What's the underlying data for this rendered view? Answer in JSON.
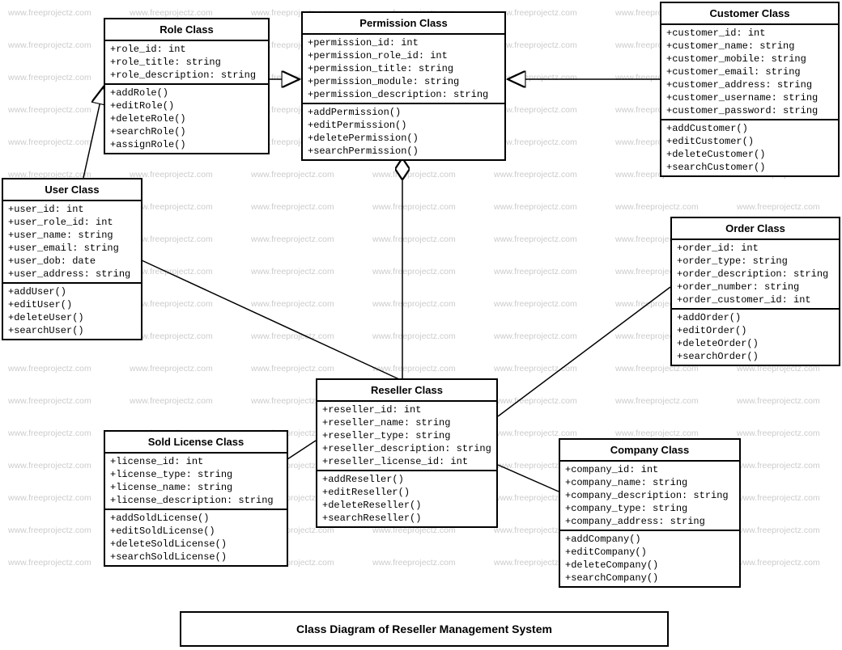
{
  "watermark": "www.freeprojectz.com",
  "caption": "Class Diagram of Reseller Management System",
  "classes": {
    "role": {
      "title": "Role Class",
      "attrs": [
        "+role_id: int",
        "+role_title: string",
        "+role_description: string"
      ],
      "ops": [
        "+addRole()",
        "+editRole()",
        "+deleteRole()",
        "+searchRole()",
        "+assignRole()"
      ]
    },
    "permission": {
      "title": "Permission Class",
      "attrs": [
        "+permission_id: int",
        "+permission_role_id: int",
        "+permission_title: string",
        "+permission_module: string",
        "+permission_description: string"
      ],
      "ops": [
        "+addPermission()",
        "+editPermission()",
        "+deletePermission()",
        "+searchPermission()"
      ]
    },
    "customer": {
      "title": "Customer Class",
      "attrs": [
        "+customer_id: int",
        "+customer_name: string",
        "+customer_mobile: string",
        "+customer_email: string",
        "+customer_address: string",
        "+customer_username: string",
        "+customer_password: string"
      ],
      "ops": [
        "+addCustomer()",
        "+editCustomer()",
        "+deleteCustomer()",
        "+searchCustomer()"
      ]
    },
    "user": {
      "title": "User Class",
      "attrs": [
        "+user_id: int",
        "+user_role_id: int",
        "+user_name: string",
        "+user_email: string",
        "+user_dob: date",
        "+user_address: string"
      ],
      "ops": [
        "+addUser()",
        "+editUser()",
        "+deleteUser()",
        "+searchUser()"
      ]
    },
    "order": {
      "title": "Order Class",
      "attrs": [
        "+order_id: int",
        "+order_type: string",
        "+order_description: string",
        "+order_number: string",
        "+order_customer_id: int"
      ],
      "ops": [
        "+addOrder()",
        "+editOrder()",
        "+deleteOrder()",
        "+searchOrder()"
      ]
    },
    "reseller": {
      "title": "Reseller  Class",
      "attrs": [
        "+reseller_id: int",
        "+reseller_name: string",
        "+reseller_type: string",
        "+reseller_description: string",
        "+reseller_license_id: int"
      ],
      "ops": [
        "+addReseller()",
        "+editReseller()",
        "+deleteReseller()",
        "+searchReseller()"
      ]
    },
    "soldlicense": {
      "title": "Sold License Class",
      "attrs": [
        "+license_id: int",
        "+license_type: string",
        "+license_name: string",
        "+license_description: string"
      ],
      "ops": [
        "+addSoldLicense()",
        "+editSoldLicense()",
        "+deleteSoldLicense()",
        "+searchSoldLicense()"
      ]
    },
    "company": {
      "title": "Company Class",
      "attrs": [
        "+company_id: int",
        "+company_name: string",
        "+company_description: string",
        "+company_type: string",
        "+company_address: string"
      ],
      "ops": [
        "+addCompany()",
        "+editCompany()",
        "+deleteCompany()",
        "+searchCompany()"
      ]
    }
  }
}
